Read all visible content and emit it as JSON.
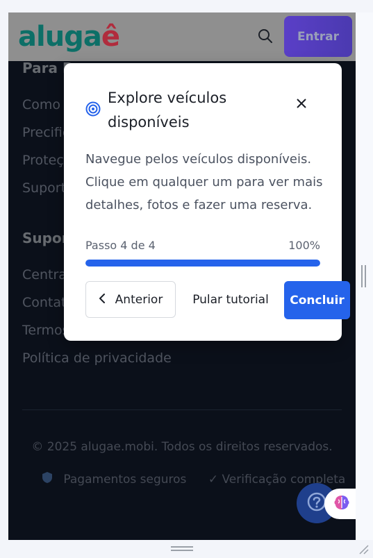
{
  "header": {
    "logo_part1": "aluga",
    "logo_part2": "ê",
    "enter_label": "Entrar"
  },
  "footer": {
    "section1_heading": "Para P",
    "section1_links": [
      "Como",
      "Precific",
      "Proteç",
      "Suport"
    ],
    "section2_heading": "Supor",
    "section2_links": [
      "Centra",
      "Contat",
      "Termos",
      "Política de privacidade"
    ],
    "copyright": "© 2025 alugae.mobi. Todos os direitos reservados.",
    "badge_secure": "Pagamentos seguros",
    "badge_verified": "✓ Verificação completa"
  },
  "modal": {
    "title": "Explore veículos disponíveis",
    "body": "Navegue pelos veículos disponíveis. Clique em qualquer um para ver mais detalhes, fotos e fazer uma reserva.",
    "step_label": "Passo 4 de 4",
    "progress_text": "100%",
    "progress_value": 1.0,
    "prev_label": "Anterior",
    "skip_label": "Pular tutorial",
    "finish_label": "Concluir"
  },
  "help": {
    "icon": "question-icon"
  },
  "colors": {
    "accent": "#2563eb",
    "dark_bg": "#0f1623",
    "brand_teal": "#0d6f67",
    "brand_red": "#b02c3d"
  }
}
